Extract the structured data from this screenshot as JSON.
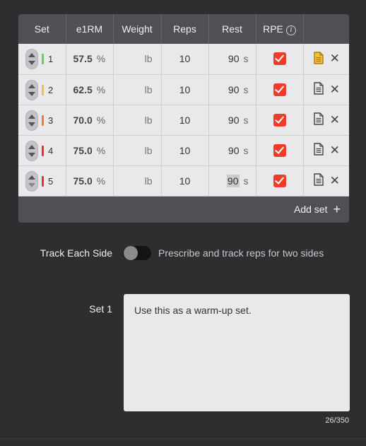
{
  "table": {
    "headers": [
      "Set",
      "e1RM",
      "Weight",
      "Reps",
      "Rest",
      "RPE",
      ""
    ],
    "rpe_info": "i",
    "rows": [
      {
        "set": "1",
        "level_color": "#4cd964",
        "e1rm": "57.5",
        "e1rm_unit": "%",
        "weight": "lb",
        "reps": "10",
        "rest": "90",
        "rest_unit": "s",
        "rpe_checked": true,
        "note_active": true
      },
      {
        "set": "2",
        "level_color": "#f5c03a",
        "e1rm": "62.5",
        "e1rm_unit": "%",
        "weight": "lb",
        "reps": "10",
        "rest": "90",
        "rest_unit": "s",
        "rpe_checked": true,
        "note_active": false
      },
      {
        "set": "3",
        "level_color": "#f07a2a",
        "e1rm": "70.0",
        "e1rm_unit": "%",
        "weight": "lb",
        "reps": "10",
        "rest": "90",
        "rest_unit": "s",
        "rpe_checked": true,
        "note_active": false
      },
      {
        "set": "4",
        "level_color": "#e8322a",
        "e1rm": "75.0",
        "e1rm_unit": "%",
        "weight": "lb",
        "reps": "10",
        "rest": "90",
        "rest_unit": "s",
        "rpe_checked": true,
        "note_active": false
      },
      {
        "set": "5",
        "level_color": "#e8322a",
        "e1rm": "75.0",
        "e1rm_unit": "%",
        "weight": "lb",
        "reps": "10",
        "rest": "90",
        "rest_unit": "s",
        "rpe_checked": true,
        "note_active": false
      }
    ],
    "add_set_label": "Add set",
    "add_set_icon": "+"
  },
  "track_each_side": {
    "label": "Track Each Side",
    "enabled": false,
    "description": "Prescribe and track reps for two sides"
  },
  "set_note": {
    "label": "Set 1",
    "value": "Use this as a warm-up set.",
    "counter": "26/350"
  },
  "colors": {
    "accent_red": "#f03a2a",
    "note_active": "#f5c03a"
  }
}
